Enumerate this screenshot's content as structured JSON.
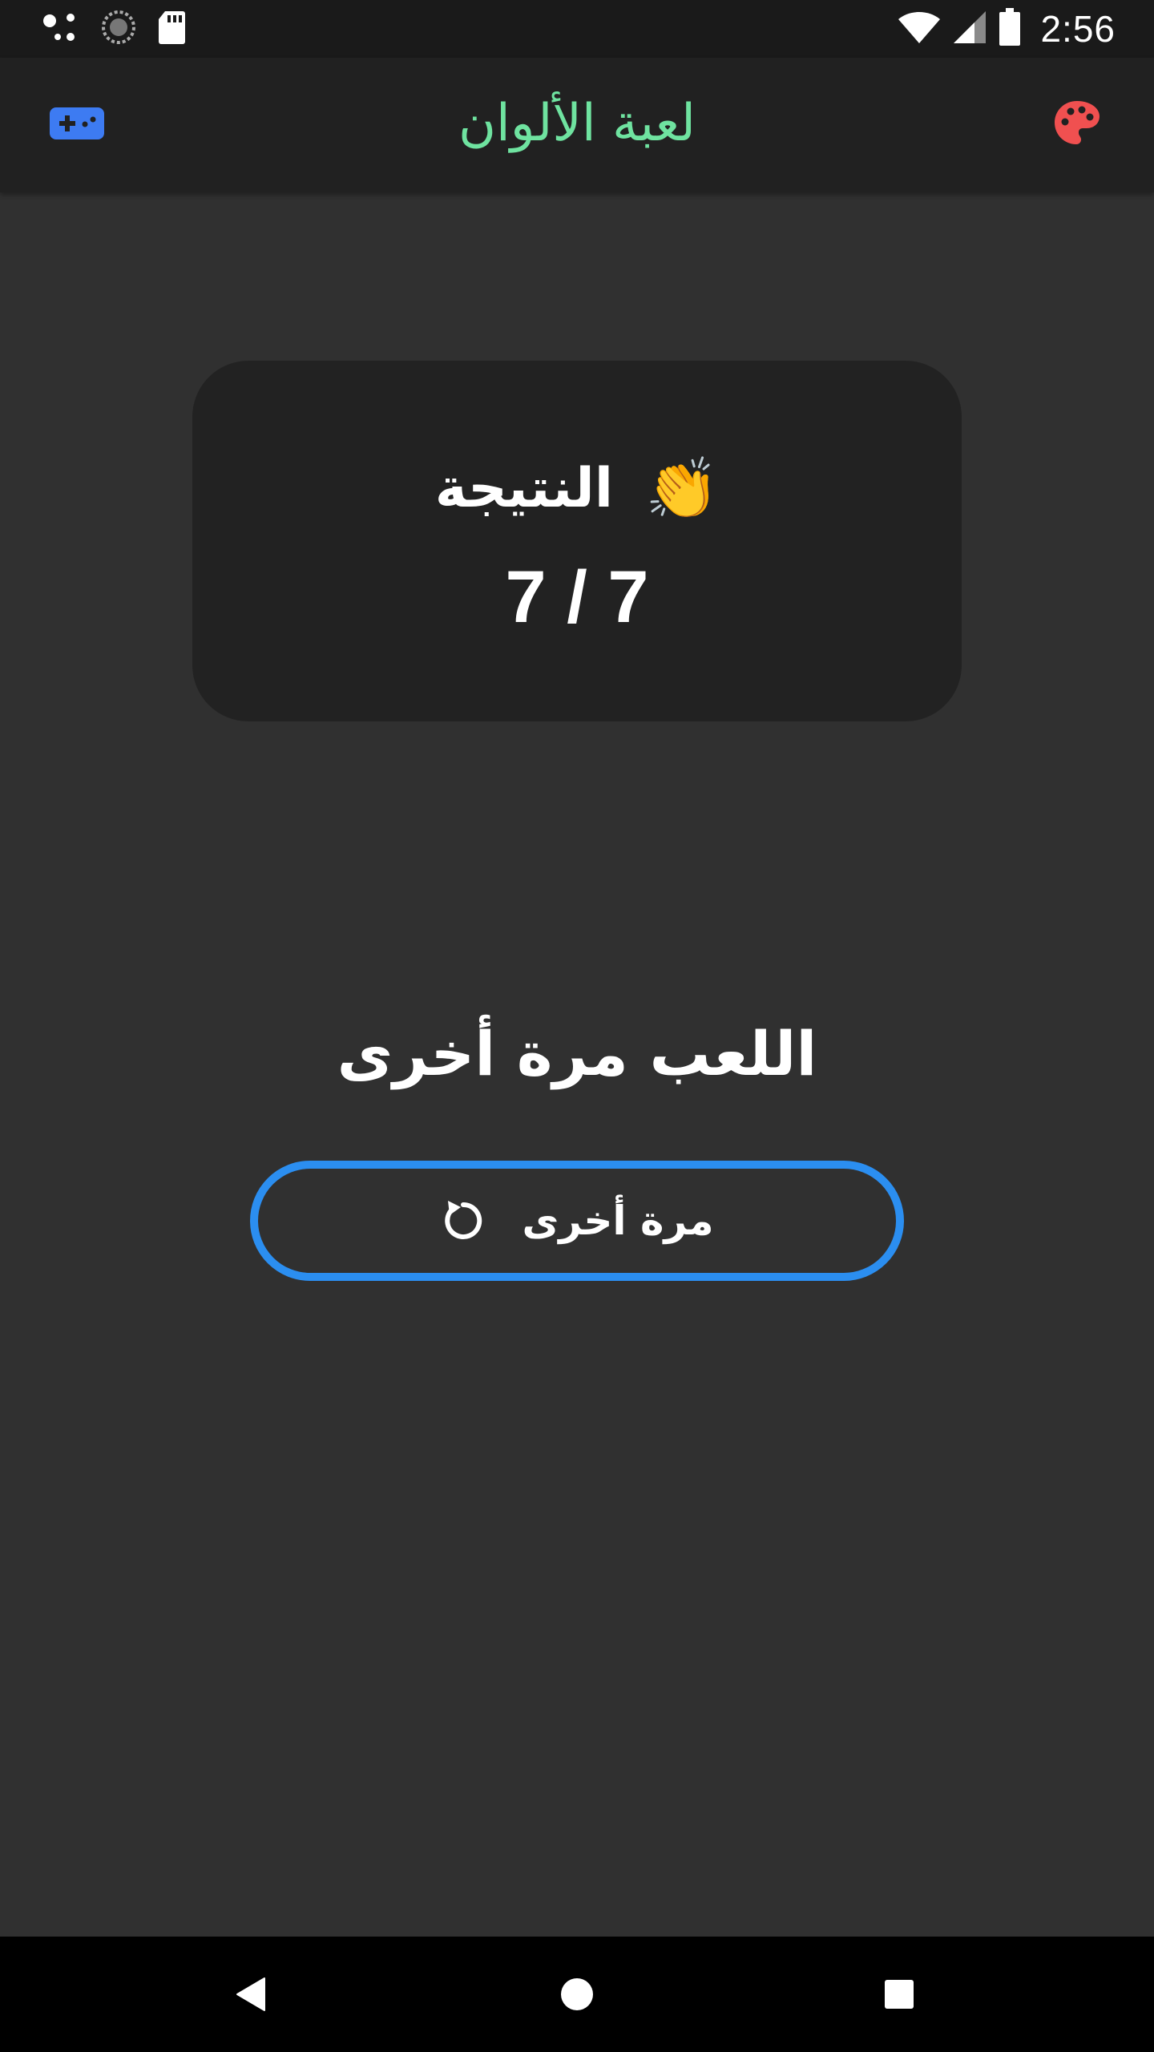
{
  "status_bar": {
    "time": "2:56",
    "left_icons": [
      "dots-icon",
      "sync-icon",
      "sd-card-icon"
    ],
    "right_icons": [
      "wifi-icon",
      "signal-icon",
      "battery-icon"
    ]
  },
  "app_bar": {
    "title": "لعبة الألوان",
    "left_icon": "gamepad-icon",
    "right_icon": "palette-icon",
    "title_color": "#6fe3a0",
    "gamepad_color": "#3d7bf2",
    "palette_color": "#f05050"
  },
  "score_card": {
    "label": "النتيجة",
    "icon": "👏",
    "value": "7 / 7"
  },
  "play_again": {
    "heading": "اللعب مرة أخرى",
    "button_label": "مرة أخرى",
    "button_icon": "replay-icon",
    "button_border_color": "#2b8ef0"
  },
  "nav_bar": {
    "buttons": [
      "back-icon",
      "home-icon",
      "recent-apps-icon"
    ]
  }
}
